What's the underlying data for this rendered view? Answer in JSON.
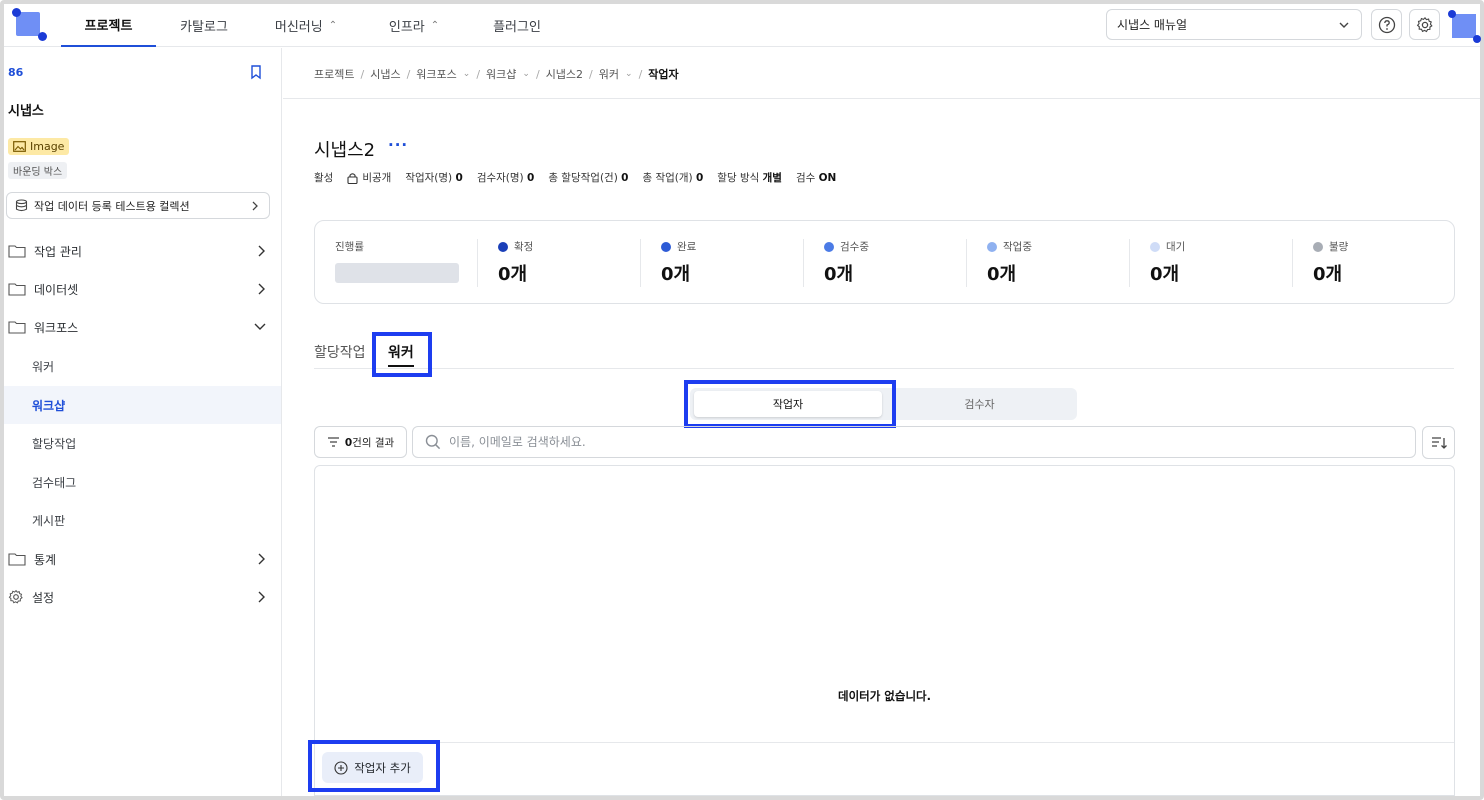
{
  "nav": {
    "tabs": [
      {
        "label": "프로젝트"
      },
      {
        "label": "카탈로그"
      },
      {
        "label": "머신러닝"
      },
      {
        "label": "인프라"
      },
      {
        "label": "플러그인"
      }
    ],
    "manual_select": "시냅스 매뉴얼"
  },
  "sidebar": {
    "project_id": "86",
    "project_name": "시냅스",
    "tag_image": "Image",
    "tag_box": "바운딩 박스",
    "collection": "작업 데이터 등록 테스트용 컬렉션",
    "menu": [
      {
        "label": "작업 관리"
      },
      {
        "label": "데이터셋"
      },
      {
        "label": "워크포스"
      },
      {
        "label": "통계"
      },
      {
        "label": "설정"
      }
    ],
    "sub_items": [
      {
        "label": "워커"
      },
      {
        "label": "워크샵"
      },
      {
        "label": "할당작업"
      },
      {
        "label": "검수태그"
      },
      {
        "label": "게시판"
      }
    ]
  },
  "breadcrumb": {
    "items": [
      "프로젝트",
      "시냅스",
      "워크포스",
      "워크샵",
      "시냅스2",
      "워커"
    ],
    "current": "작업자"
  },
  "page": {
    "title": "시냅스2",
    "more": "···"
  },
  "meta": {
    "status": "활성",
    "visibility": "비공개",
    "workers_label": "작업자(명)",
    "workers_val": "0",
    "reviewers_label": "검수자(명)",
    "reviewers_val": "0",
    "assigned_label": "총 할당작업(건)",
    "assigned_val": "0",
    "tasks_label": "총 작업(개)",
    "tasks_val": "0",
    "method_label": "할당 방식",
    "method_val": "개별",
    "review_label": "검수",
    "review_val": "ON"
  },
  "stats": {
    "progress_label": "진행률",
    "items": [
      {
        "label": "확정",
        "value": "0개",
        "color": "#1a3fb8"
      },
      {
        "label": "완료",
        "value": "0개",
        "color": "#2d5bd6"
      },
      {
        "label": "검수중",
        "value": "0개",
        "color": "#4b7be6"
      },
      {
        "label": "작업중",
        "value": "0개",
        "color": "#8fb1f0"
      },
      {
        "label": "대기",
        "value": "0개",
        "color": "#cfdcf7"
      },
      {
        "label": "불량",
        "value": "0개",
        "color": "#a8adb5"
      }
    ]
  },
  "tabs": [
    {
      "label": "할당작업"
    },
    {
      "label": "워커"
    }
  ],
  "segment": {
    "worker": "작업자",
    "reviewer": "검수자"
  },
  "toolbar": {
    "result_count": "0",
    "result_suffix": "건의 결과",
    "search_placeholder": "이름, 이메일로 검색하세요."
  },
  "table": {
    "empty": "데이터가 없습니다."
  },
  "footer": {
    "add_worker": "작업자 추가"
  },
  "colors": {
    "accent": "#1f4fd8",
    "highlight": "#1d3df0"
  }
}
